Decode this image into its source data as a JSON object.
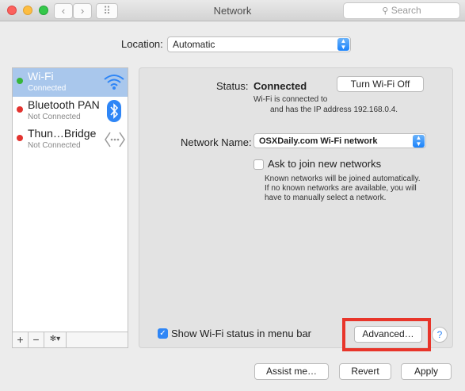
{
  "window": {
    "title": "Network",
    "search_placeholder": "Search"
  },
  "toolbar": {
    "back_glyph": "‹",
    "forward_glyph": "›",
    "grid_glyph": "⠿"
  },
  "location": {
    "label": "Location:",
    "value": "Automatic"
  },
  "sidebar": {
    "services": [
      {
        "name": "Wi-Fi",
        "status": "Connected",
        "status_color": "#37b63b",
        "icon": "wifi-icon"
      },
      {
        "name": "Bluetooth PAN",
        "status": "Not Connected",
        "status_color": "#e3332f",
        "icon": "bluetooth-icon"
      },
      {
        "name": "Thun…Bridge",
        "status": "Not Connected",
        "status_color": "#e3332f",
        "icon": "thunderbolt-bridge-icon"
      }
    ],
    "add_glyph": "+",
    "remove_glyph": "−",
    "action_glyph": "✻▾"
  },
  "detail": {
    "status_label": "Status:",
    "status_value": "Connected",
    "turn_off_button": "Turn Wi-Fi Off",
    "status_desc_line1": "Wi-Fi is connected to",
    "status_desc_line2": "and has the IP address 192.168.0.4.",
    "network_name_label": "Network Name:",
    "network_name_value": "OSXDaily.com Wi-Fi network",
    "ask_join_label": "Ask to join new networks",
    "ask_join_desc_line1": "Known networks will be joined automatically.",
    "ask_join_desc_line2": "If no known networks are available, you will",
    "ask_join_desc_line3": "have to manually select a network.",
    "show_status_label": "Show Wi-Fi status in menu bar",
    "advanced_button": "Advanced…",
    "help_glyph": "?"
  },
  "footer": {
    "assist_button": "Assist me…",
    "revert_button": "Revert",
    "apply_button": "Apply"
  },
  "colors": {
    "accent": "#2f86f6",
    "highlight_box": "#e8352a",
    "selected_row": "#a9c7ec"
  }
}
